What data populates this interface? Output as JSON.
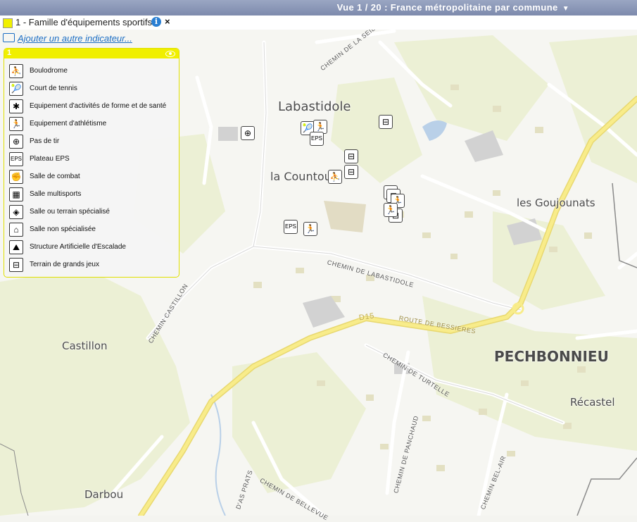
{
  "header": {
    "view_label": "Vue 1 / 20 : France métropolitaine par commune",
    "caret": "▼"
  },
  "indicator": {
    "label": "1 - Famille d'équipements sportifs",
    "info": "i",
    "close": "×"
  },
  "add_indicator": {
    "label": "Ajouter un autre indicateur..."
  },
  "legend": {
    "number": "1",
    "items": [
      {
        "label": "Boulodrome",
        "glyph": "⛹"
      },
      {
        "label": "Court de tennis",
        "glyph": "🎾"
      },
      {
        "label": "Equipement d'activités de forme et de santé",
        "glyph": "✱"
      },
      {
        "label": "Equipement d'athlétisme",
        "glyph": "🏃"
      },
      {
        "label": "Pas de tir",
        "glyph": "⊕"
      },
      {
        "label": "Plateau EPS",
        "glyph": "EPS"
      },
      {
        "label": "Salle de combat",
        "glyph": "✊"
      },
      {
        "label": "Salle multisports",
        "glyph": "▦"
      },
      {
        "label": "Salle ou terrain spécialisé",
        "glyph": "◈"
      },
      {
        "label": "Salle non spécialisée",
        "glyph": "⌂"
      },
      {
        "label": "Structure Artificielle d'Escalade",
        "glyph": "⛰"
      },
      {
        "label": "Terrain de grands jeux",
        "glyph": "⊟"
      }
    ]
  },
  "map": {
    "places": {
      "labastidole": "Labastidole",
      "la_countou": "la Countou",
      "les_goujounats": "les Goujounats",
      "castillon": "Castillon",
      "pechbonnieu": "PECHBONNIEU",
      "recastel": "Récastel",
      "darbou": "Darbou"
    },
    "roads": {
      "chemin_seille": "CHEMIN DE LA SEILLE",
      "chemin_labastidole": "CHEMIN DE LABASTIDOLE",
      "chemin_castillon": "CHEMIN CASTILLON",
      "d15": "D15",
      "route_bessieres": "ROUTE DE BESSIERES",
      "chemin_turtelle": "CHEMIN DE TURTELLE",
      "chemin_panchaud": "CHEMIN DE PANCHAUD",
      "chemin_bel_air": "CHEMIN BEL-AIR",
      "chemin_bellevue": "CHEMIN DE BELLEVUE",
      "das_prats": "D'AS PRATS"
    },
    "poi_glyphs": {
      "eps": "EPS",
      "field": "⊟",
      "athletics": "🏃",
      "tennis": "🎾",
      "boules": "⛹",
      "target": "⊕"
    }
  },
  "colors": {
    "legend_accent": "#f0ef00",
    "link": "#1c6ec4",
    "road_major": "#f5e36a",
    "green": "#eaefcf"
  }
}
